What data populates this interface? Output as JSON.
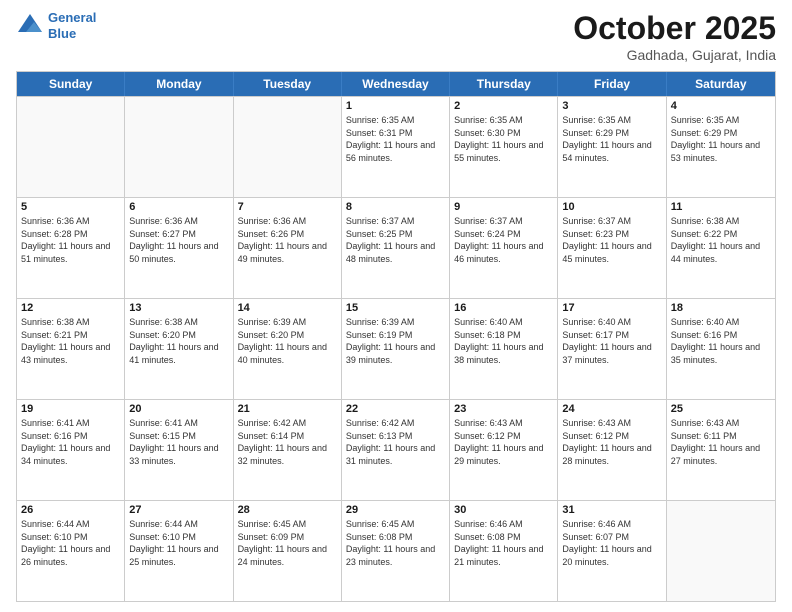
{
  "header": {
    "logo_line1": "General",
    "logo_line2": "Blue",
    "month": "October 2025",
    "location": "Gadhada, Gujarat, India"
  },
  "days_of_week": [
    "Sunday",
    "Monday",
    "Tuesday",
    "Wednesday",
    "Thursday",
    "Friday",
    "Saturday"
  ],
  "weeks": [
    [
      {
        "day": "",
        "sunrise": "",
        "sunset": "",
        "daylight": ""
      },
      {
        "day": "",
        "sunrise": "",
        "sunset": "",
        "daylight": ""
      },
      {
        "day": "",
        "sunrise": "",
        "sunset": "",
        "daylight": ""
      },
      {
        "day": "1",
        "sunrise": "Sunrise: 6:35 AM",
        "sunset": "Sunset: 6:31 PM",
        "daylight": "Daylight: 11 hours and 56 minutes."
      },
      {
        "day": "2",
        "sunrise": "Sunrise: 6:35 AM",
        "sunset": "Sunset: 6:30 PM",
        "daylight": "Daylight: 11 hours and 55 minutes."
      },
      {
        "day": "3",
        "sunrise": "Sunrise: 6:35 AM",
        "sunset": "Sunset: 6:29 PM",
        "daylight": "Daylight: 11 hours and 54 minutes."
      },
      {
        "day": "4",
        "sunrise": "Sunrise: 6:35 AM",
        "sunset": "Sunset: 6:29 PM",
        "daylight": "Daylight: 11 hours and 53 minutes."
      }
    ],
    [
      {
        "day": "5",
        "sunrise": "Sunrise: 6:36 AM",
        "sunset": "Sunset: 6:28 PM",
        "daylight": "Daylight: 11 hours and 51 minutes."
      },
      {
        "day": "6",
        "sunrise": "Sunrise: 6:36 AM",
        "sunset": "Sunset: 6:27 PM",
        "daylight": "Daylight: 11 hours and 50 minutes."
      },
      {
        "day": "7",
        "sunrise": "Sunrise: 6:36 AM",
        "sunset": "Sunset: 6:26 PM",
        "daylight": "Daylight: 11 hours and 49 minutes."
      },
      {
        "day": "8",
        "sunrise": "Sunrise: 6:37 AM",
        "sunset": "Sunset: 6:25 PM",
        "daylight": "Daylight: 11 hours and 48 minutes."
      },
      {
        "day": "9",
        "sunrise": "Sunrise: 6:37 AM",
        "sunset": "Sunset: 6:24 PM",
        "daylight": "Daylight: 11 hours and 46 minutes."
      },
      {
        "day": "10",
        "sunrise": "Sunrise: 6:37 AM",
        "sunset": "Sunset: 6:23 PM",
        "daylight": "Daylight: 11 hours and 45 minutes."
      },
      {
        "day": "11",
        "sunrise": "Sunrise: 6:38 AM",
        "sunset": "Sunset: 6:22 PM",
        "daylight": "Daylight: 11 hours and 44 minutes."
      }
    ],
    [
      {
        "day": "12",
        "sunrise": "Sunrise: 6:38 AM",
        "sunset": "Sunset: 6:21 PM",
        "daylight": "Daylight: 11 hours and 43 minutes."
      },
      {
        "day": "13",
        "sunrise": "Sunrise: 6:38 AM",
        "sunset": "Sunset: 6:20 PM",
        "daylight": "Daylight: 11 hours and 41 minutes."
      },
      {
        "day": "14",
        "sunrise": "Sunrise: 6:39 AM",
        "sunset": "Sunset: 6:20 PM",
        "daylight": "Daylight: 11 hours and 40 minutes."
      },
      {
        "day": "15",
        "sunrise": "Sunrise: 6:39 AM",
        "sunset": "Sunset: 6:19 PM",
        "daylight": "Daylight: 11 hours and 39 minutes."
      },
      {
        "day": "16",
        "sunrise": "Sunrise: 6:40 AM",
        "sunset": "Sunset: 6:18 PM",
        "daylight": "Daylight: 11 hours and 38 minutes."
      },
      {
        "day": "17",
        "sunrise": "Sunrise: 6:40 AM",
        "sunset": "Sunset: 6:17 PM",
        "daylight": "Daylight: 11 hours and 37 minutes."
      },
      {
        "day": "18",
        "sunrise": "Sunrise: 6:40 AM",
        "sunset": "Sunset: 6:16 PM",
        "daylight": "Daylight: 11 hours and 35 minutes."
      }
    ],
    [
      {
        "day": "19",
        "sunrise": "Sunrise: 6:41 AM",
        "sunset": "Sunset: 6:16 PM",
        "daylight": "Daylight: 11 hours and 34 minutes."
      },
      {
        "day": "20",
        "sunrise": "Sunrise: 6:41 AM",
        "sunset": "Sunset: 6:15 PM",
        "daylight": "Daylight: 11 hours and 33 minutes."
      },
      {
        "day": "21",
        "sunrise": "Sunrise: 6:42 AM",
        "sunset": "Sunset: 6:14 PM",
        "daylight": "Daylight: 11 hours and 32 minutes."
      },
      {
        "day": "22",
        "sunrise": "Sunrise: 6:42 AM",
        "sunset": "Sunset: 6:13 PM",
        "daylight": "Daylight: 11 hours and 31 minutes."
      },
      {
        "day": "23",
        "sunrise": "Sunrise: 6:43 AM",
        "sunset": "Sunset: 6:12 PM",
        "daylight": "Daylight: 11 hours and 29 minutes."
      },
      {
        "day": "24",
        "sunrise": "Sunrise: 6:43 AM",
        "sunset": "Sunset: 6:12 PM",
        "daylight": "Daylight: 11 hours and 28 minutes."
      },
      {
        "day": "25",
        "sunrise": "Sunrise: 6:43 AM",
        "sunset": "Sunset: 6:11 PM",
        "daylight": "Daylight: 11 hours and 27 minutes."
      }
    ],
    [
      {
        "day": "26",
        "sunrise": "Sunrise: 6:44 AM",
        "sunset": "Sunset: 6:10 PM",
        "daylight": "Daylight: 11 hours and 26 minutes."
      },
      {
        "day": "27",
        "sunrise": "Sunrise: 6:44 AM",
        "sunset": "Sunset: 6:10 PM",
        "daylight": "Daylight: 11 hours and 25 minutes."
      },
      {
        "day": "28",
        "sunrise": "Sunrise: 6:45 AM",
        "sunset": "Sunset: 6:09 PM",
        "daylight": "Daylight: 11 hours and 24 minutes."
      },
      {
        "day": "29",
        "sunrise": "Sunrise: 6:45 AM",
        "sunset": "Sunset: 6:08 PM",
        "daylight": "Daylight: 11 hours and 23 minutes."
      },
      {
        "day": "30",
        "sunrise": "Sunrise: 6:46 AM",
        "sunset": "Sunset: 6:08 PM",
        "daylight": "Daylight: 11 hours and 21 minutes."
      },
      {
        "day": "31",
        "sunrise": "Sunrise: 6:46 AM",
        "sunset": "Sunset: 6:07 PM",
        "daylight": "Daylight: 11 hours and 20 minutes."
      },
      {
        "day": "",
        "sunrise": "",
        "sunset": "",
        "daylight": ""
      }
    ]
  ]
}
